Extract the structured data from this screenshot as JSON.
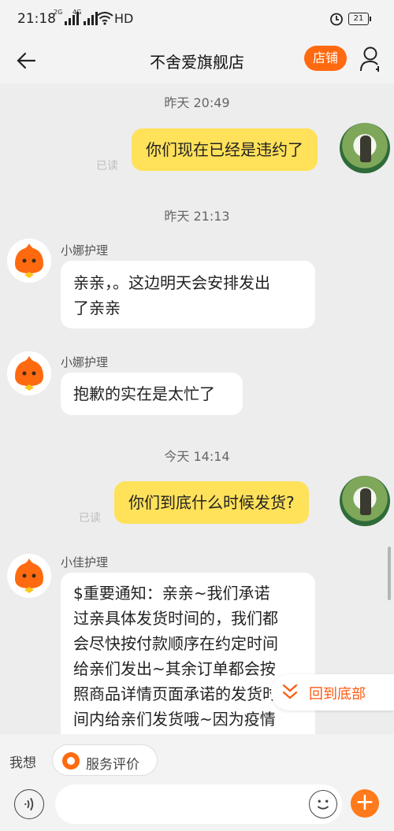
{
  "status_bar": {
    "time": "21:18",
    "sig1_tag": "2G",
    "sig2_tag": "4G",
    "network": "HD",
    "battery": "21"
  },
  "header": {
    "title": "不舍爱旗舰店",
    "shop_button": "店铺"
  },
  "messages": {
    "ts1": "昨天  20:49",
    "out1": "你们现在已经是违约了",
    "read1": "已读",
    "ts2": "昨天  21:13",
    "sender1": "小娜护理",
    "in1_line1": "亲亲，。这边明天会安排发出",
    "in1_line2": "了亲亲",
    "sender2": "小娜护理",
    "in2": "抱歉的实在是太忙了",
    "ts3": "今天  14:14",
    "out2": "你们到底什么时候发货?",
    "read2": "已读",
    "sender3": "小佳护理",
    "in3_lines": [
      "$重要通知：亲亲~我们承诺",
      "过亲具体发货时间的，我们都",
      "会尽快按付款顺序在约定时间",
      "给亲们发出~其余订单都会按",
      "照商品详情页面承诺的发货时",
      "间内给亲们发货哦~因为疫情"
    ]
  },
  "to_bottom": "回到底部",
  "quick_bar": {
    "label": "我想",
    "chip": "服务评价"
  },
  "colors": {
    "accent": "#ff6a10",
    "bubble_out": "#ffe15a"
  }
}
